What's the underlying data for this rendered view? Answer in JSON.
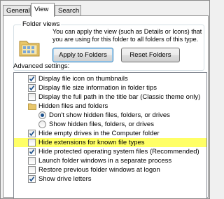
{
  "tabs": [
    "General",
    "View",
    "Search"
  ],
  "folder_views": {
    "title": "Folder views",
    "description": "You can apply the view (such as Details or Icons) that you are using for this folder to all folders of this type.",
    "apply_label": "Apply to Folders",
    "reset_label": "Reset Folders"
  },
  "advanced": {
    "label": "Advanced settings:",
    "items": [
      {
        "label": "Display file icon on thumbnails",
        "kind": "checkbox",
        "checked": true
      },
      {
        "label": "Display file size information in folder tips",
        "kind": "checkbox",
        "checked": true
      },
      {
        "label": "Display the full path in the title bar (Classic theme only)",
        "kind": "checkbox",
        "checked": false
      },
      {
        "label": "Hidden files and folders",
        "kind": "folder"
      },
      {
        "label": "Don't show hidden files, folders, or drives",
        "kind": "radio",
        "checked": true
      },
      {
        "label": "Show hidden files, folders, or drives",
        "kind": "radio",
        "checked": false
      },
      {
        "label": "Hide empty drives in the Computer folder",
        "kind": "checkbox",
        "checked": true
      },
      {
        "label": "Hide extensions for known file types",
        "kind": "checkbox",
        "checked": false,
        "highlight": true
      },
      {
        "label": "Hide protected operating system files (Recommended)",
        "kind": "checkbox",
        "checked": true
      },
      {
        "label": "Launch folder windows in a separate process",
        "kind": "checkbox",
        "checked": false
      },
      {
        "label": "Restore previous folder windows at logon",
        "kind": "checkbox",
        "checked": false
      },
      {
        "label": "Show drive letters",
        "kind": "checkbox",
        "checked": true
      }
    ]
  },
  "colors": {
    "highlight": "#ffff66",
    "check": "#1a4f8b"
  }
}
